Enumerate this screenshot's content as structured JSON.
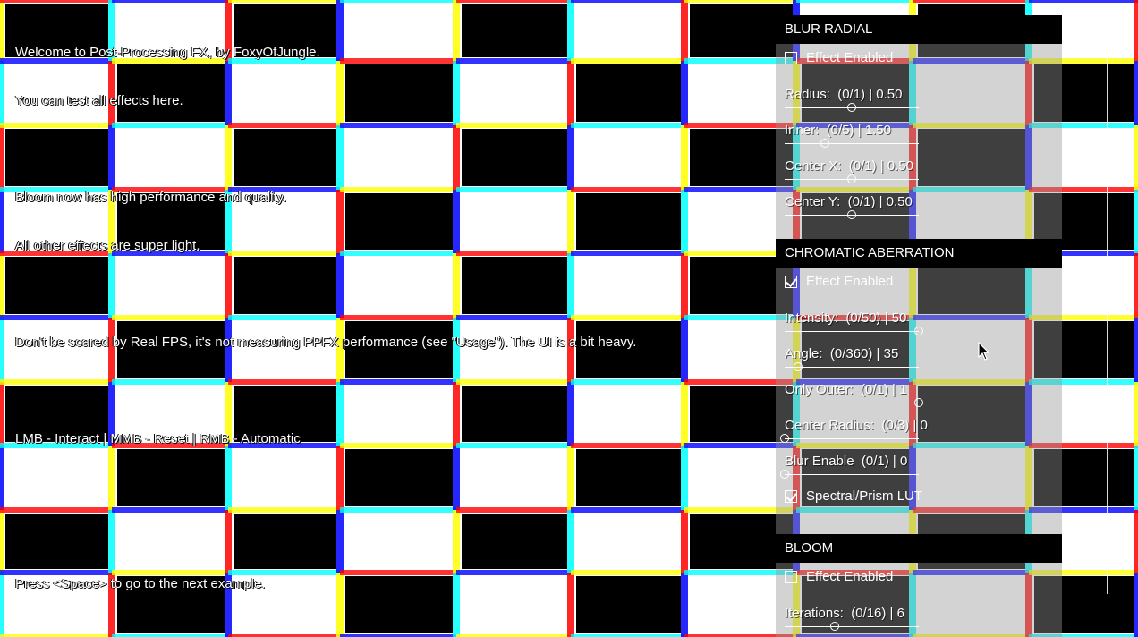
{
  "intro": {
    "line1": "Welcome to Post-Processing FX, by FoxyOfJungle.",
    "line2": "You can test all effects here.",
    "line3": "Bloom now has high performance and quality.",
    "line4": "All other effects are super light.",
    "line5": "Don't be scared by Real FPS, it's not measuring PPFX performance (see \"Usage\"). The UI is a bit heavy.",
    "line6": "LMB - Interact | MMB - Reset | RMB - Automatic",
    "line7": "Press <Space> to go to the next example."
  },
  "blur_radial": {
    "title": "BLUR RADIAL",
    "enabled_label": "Effect Enabled",
    "enabled": false,
    "radius": {
      "label": "Radius:  (0/1) | 0.50",
      "fraction": 0.5
    },
    "inner": {
      "label": "Inner:  (0/5) | 1.50",
      "fraction": 0.3
    },
    "center_x": {
      "label": "Center X:  (0/1) | 0.50",
      "fraction": 0.5
    },
    "center_y": {
      "label": "Center Y:  (0/1) | 0.50",
      "fraction": 0.5
    }
  },
  "chromatic_aberration": {
    "title": "CHROMATIC ABERRATION",
    "enabled_label": "Effect Enabled",
    "enabled": true,
    "intensity": {
      "label": "Intensity:  (0/50) | 50",
      "fraction": 1.0
    },
    "angle": {
      "label": "Angle:  (0/360) | 35",
      "fraction": 0.097
    },
    "only_outer": {
      "label": "Only Outer:  (0/1) | 1",
      "fraction": 1.0
    },
    "center_radius": {
      "label": "Center Radius:  (0/3) | 0",
      "fraction": 0.0
    },
    "blur_enable": {
      "label": "Blur Enable  (0/1) | 0",
      "fraction": 0.0
    },
    "spectral_label": "Spectral/Prism LUT",
    "spectral": true
  },
  "bloom": {
    "title": "BLOOM",
    "enabled_label": "Effect Enabled",
    "enabled": false,
    "iterations": {
      "label": "Iterations:  (0/16) | 6",
      "fraction": 0.375
    }
  }
}
